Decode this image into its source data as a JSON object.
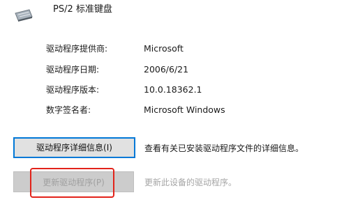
{
  "device": {
    "icon": "keyboard-icon",
    "name": "PS/2 标准键盘"
  },
  "properties": [
    {
      "label": "驱动程序提供商:",
      "value": "Microsoft"
    },
    {
      "label": "驱动程序日期:",
      "value": "2006/6/21"
    },
    {
      "label": "驱动程序版本:",
      "value": "10.0.18362.1"
    },
    {
      "label": "数字签名者:",
      "value": "Microsoft Windows"
    }
  ],
  "actions": {
    "details": {
      "label": "驱动程序详细信息(I)",
      "description": "查看有关已安装驱动程序文件的详细信息。",
      "enabled": true
    },
    "update": {
      "label": "更新驱动程序(P)",
      "description": "更新此设备的驱动程序。",
      "enabled": false
    }
  },
  "colors": {
    "focus_border": "#0078d7",
    "highlight": "#e2231a",
    "disabled_text": "#a0a0a0"
  }
}
